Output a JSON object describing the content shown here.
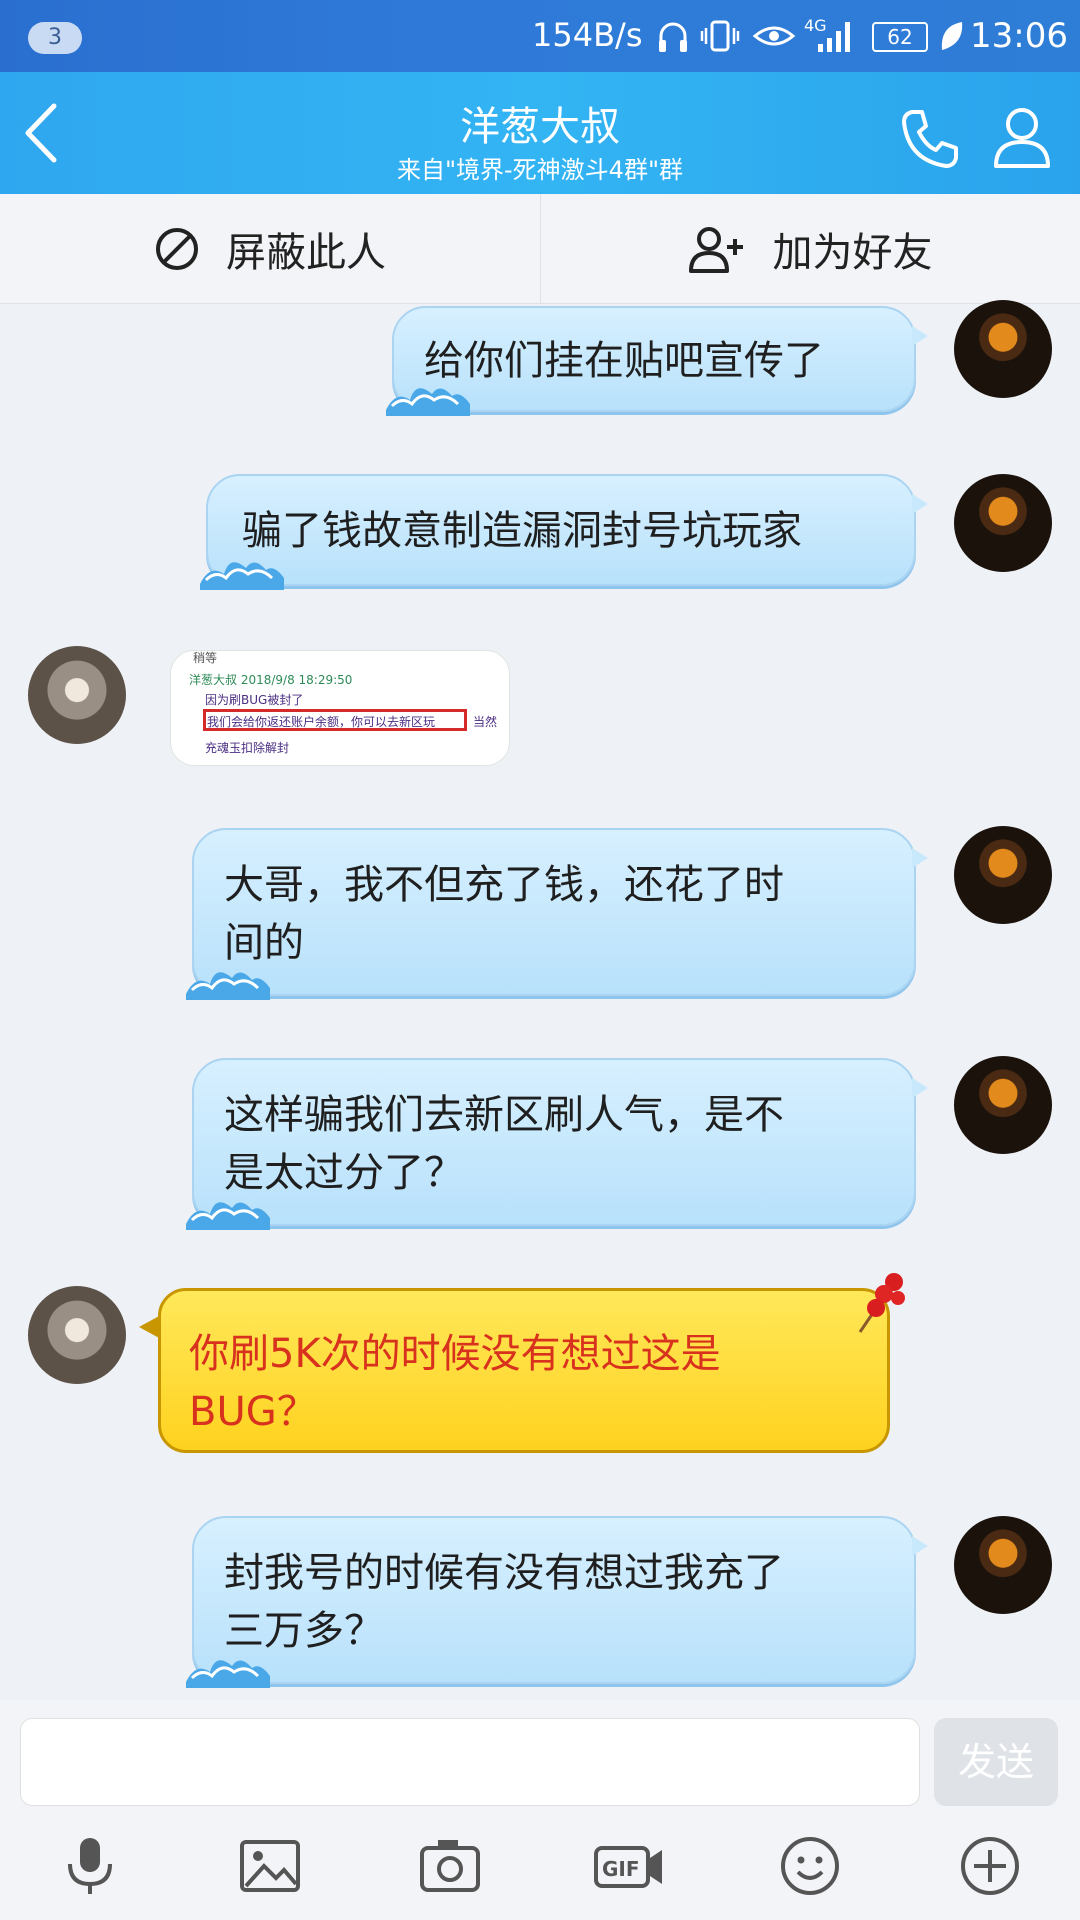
{
  "status_bar": {
    "notification_count": "3",
    "net_speed": "154B/s",
    "network": "4G",
    "battery": "62",
    "time": "13:06",
    "icons": [
      "headphones-icon",
      "vibrate-icon",
      "eye-icon",
      "signal-icon",
      "battery-icon",
      "leaf-icon"
    ]
  },
  "header": {
    "title": "洋葱大叔",
    "subtitle": "来自\"境界-死神激斗4群\"群",
    "icons": [
      "back-icon",
      "phone-icon",
      "profile-icon"
    ]
  },
  "actions": {
    "block_label": "屏蔽此人",
    "add_friend_label": "加为好友"
  },
  "messages": [
    {
      "from": "me",
      "line1": "给你们挂在贴吧宣传了",
      "line2": ""
    },
    {
      "from": "me",
      "line1": "骗了钱故意制造漏洞封号坑玩家",
      "line2": ""
    },
    {
      "from": "other",
      "type": "image",
      "lines": [
        "稍等",
        "洋葱大叔 2018/9/8 18:29:50",
        "因为刷BUG被封了",
        "我们会给你返还账户余额，你可以去新区玩",
        "充魂玉扣除解封",
        "当然"
      ]
    },
    {
      "from": "me",
      "line1": "大哥，我不但充了钱，还花了时",
      "line2": "间的"
    },
    {
      "from": "me",
      "line1": "这样骗我们去新区刷人气，是不",
      "line2": "是太过分了？"
    },
    {
      "from": "other",
      "line1": "你刷5K次的时候没有想过这是",
      "line2": "BUG？"
    },
    {
      "from": "me",
      "line1": "封我号的时候有没有想过我充了",
      "line2": "三万多？"
    }
  ],
  "input": {
    "placeholder": "",
    "send_label": "发送"
  },
  "toolbar_icons": [
    "mic-icon",
    "image-icon",
    "camera-icon",
    "gif-icon",
    "emoji-icon",
    "plus-icon"
  ]
}
